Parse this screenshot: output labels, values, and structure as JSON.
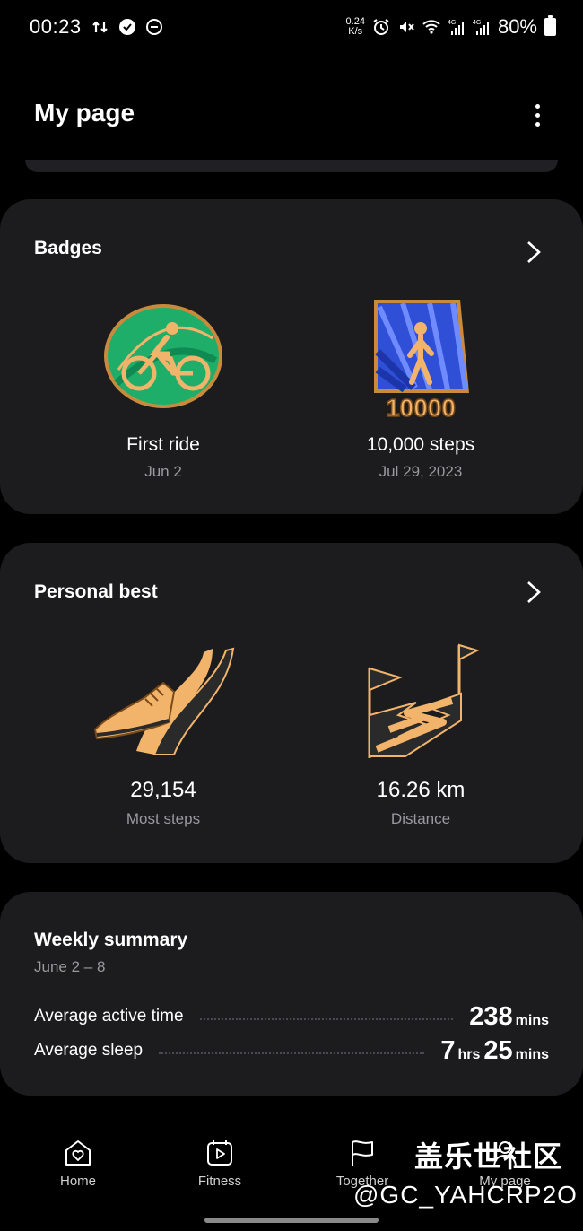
{
  "status_bar": {
    "time": "00:23",
    "net_speed_value": "0.24",
    "net_speed_unit": "K/s",
    "network_1": "4G",
    "network_2": "4G",
    "battery": "80%"
  },
  "header": {
    "title": "My page"
  },
  "badges": {
    "title": "Badges",
    "items": [
      {
        "name": "First ride",
        "date": "Jun 2",
        "icon": "cycling-badge-icon"
      },
      {
        "name": "10,000 steps",
        "date": "Jul 29, 2023",
        "icon": "10000-steps-badge-icon",
        "badge_text": "10000"
      }
    ]
  },
  "personal_best": {
    "title": "Personal best",
    "items": [
      {
        "value": "29,154",
        "label": "Most steps",
        "icon": "shoe-ribbon-icon"
      },
      {
        "value": "16.26 km",
        "label": "Distance",
        "icon": "flag-road-icon"
      }
    ]
  },
  "weekly_summary": {
    "title": "Weekly summary",
    "range": "June 2 – 8",
    "rows": [
      {
        "label": "Average active time",
        "num1": "238",
        "unit1": "mins"
      },
      {
        "label": "Average sleep",
        "num1": "7",
        "unit1": "hrs",
        "num2": "25",
        "unit2": "mins"
      }
    ]
  },
  "nav": {
    "items": [
      {
        "label": "Home",
        "icon": "heart-home-icon"
      },
      {
        "label": "Fitness",
        "icon": "fitness-play-icon"
      },
      {
        "label": "Together",
        "icon": "flag-icon"
      },
      {
        "label": "My page",
        "icon": "person-icon"
      }
    ]
  },
  "watermark": {
    "line1": "盖乐世社区",
    "line2": "@GC_YAHCRP2O"
  },
  "colors": {
    "background": "#000000",
    "card": "#1c1c1e",
    "secondary_text": "#9a9a9e",
    "badge_gold": "#f2b46a",
    "badge_green": "#1fae6a",
    "badge_blue": "#2f4fd6"
  }
}
